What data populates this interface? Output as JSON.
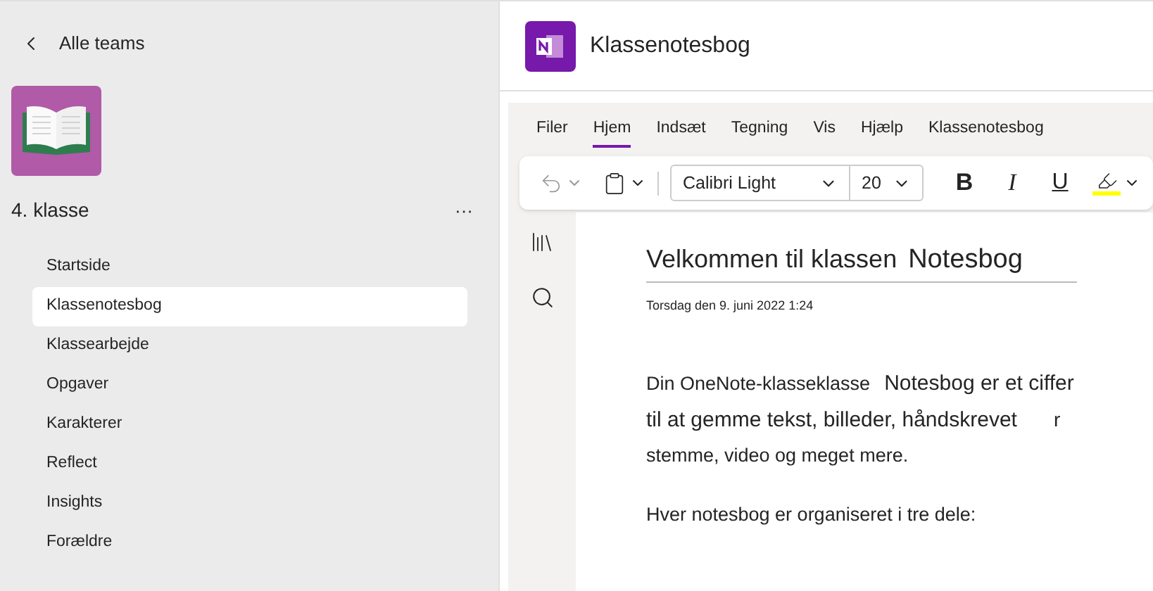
{
  "sidebar": {
    "back_label": "Alle teams",
    "team_name": "4. klasse",
    "more": "···",
    "items": [
      {
        "label": "Startside",
        "selected": false
      },
      {
        "label": "Klassenotesbog",
        "selected": true
      },
      {
        "label": "Klassearbejde",
        "selected": false
      },
      {
        "label": "Opgaver",
        "selected": false
      },
      {
        "label": "Karakterer",
        "selected": false
      },
      {
        "label": "Reflect",
        "selected": false
      },
      {
        "label": "Insights",
        "selected": false
      },
      {
        "label": "Forældre",
        "selected": false
      }
    ]
  },
  "app": {
    "title": "Klassenotesbog"
  },
  "ribbon_tabs": [
    {
      "label": "Filer",
      "selected": false
    },
    {
      "label": "Hjem",
      "selected": true
    },
    {
      "label": "Indsæt",
      "selected": false
    },
    {
      "label": "Tegning",
      "selected": false
    },
    {
      "label": "Vis",
      "selected": false
    },
    {
      "label": "Hjælp",
      "selected": false
    },
    {
      "label": "Klassenotesbog",
      "selected": false
    }
  ],
  "toolbar": {
    "font": "Calibri Light",
    "size": "20",
    "bold": "B",
    "italic": "I",
    "underline": "U"
  },
  "page": {
    "title_parts": [
      "Velkommen til klassen",
      "Notesbog"
    ],
    "date": "Torsdag den 9. juni 2022 1:24",
    "lines": [
      [
        "Din OneNote-klasseklasse",
        "Notesbog er et ciffer"
      ],
      [
        "til at gemme tekst, billeder, håndskrevet",
        "r"
      ],
      [
        "stemme, video og meget mere."
      ]
    ],
    "paragraph2": "Hver notesbog er organiseret i tre dele:"
  }
}
